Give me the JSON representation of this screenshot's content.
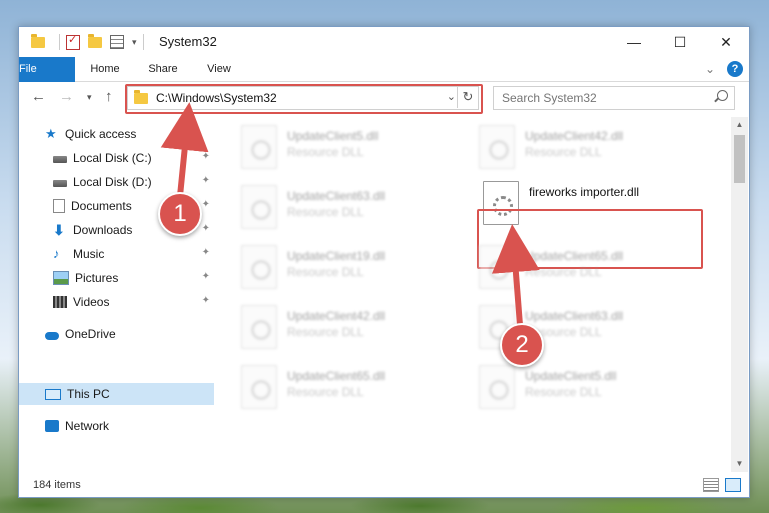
{
  "window": {
    "title": "System32",
    "minimize_label": "—",
    "maximize_label": "☐",
    "close_label": "✕"
  },
  "ribbon": {
    "tabs": [
      {
        "label": "File"
      },
      {
        "label": "Home"
      },
      {
        "label": "Share"
      },
      {
        "label": "View"
      }
    ],
    "expand_label": "⌄",
    "help_label": "?"
  },
  "address_bar": {
    "path": "C:\\Windows\\System32",
    "dropdown": "⌄",
    "refresh": "↻"
  },
  "search": {
    "placeholder": "Search System32"
  },
  "nav_pane": {
    "items": [
      {
        "label": "Quick access"
      },
      {
        "label": "Local Disk (C:)"
      },
      {
        "label": "Local Disk (D:)"
      },
      {
        "label": "Documents"
      },
      {
        "label": "Downloads"
      },
      {
        "label": "Music"
      },
      {
        "label": "Pictures"
      },
      {
        "label": "Videos"
      },
      {
        "label": "OneDrive"
      },
      {
        "label": "This PC"
      },
      {
        "label": "Network"
      }
    ],
    "pin": "📌"
  },
  "files": [
    {
      "name": "UpdateClient5.dll",
      "type": "Resource DLL"
    },
    {
      "name": "UpdateClient42.dll",
      "type": "Resource DLL"
    },
    {
      "name": "UpdateClient63.dll",
      "type": "Resource DLL"
    },
    {
      "name": "fireworks importer.dll",
      "type": ""
    },
    {
      "name": "UpdateClient19.dll",
      "type": "Resource DLL"
    },
    {
      "name": "UpdateClient65.dll",
      "type": "Resource DLL"
    },
    {
      "name": "UpdateClient42.dll",
      "type": "Resource DLL"
    },
    {
      "name": "UpdateClient63.dll",
      "type": "Resource DLL"
    },
    {
      "name": "UpdateClient65.dll",
      "type": "Resource DLL"
    },
    {
      "name": "UpdateClient5.dll",
      "type": "Resource DLL"
    }
  ],
  "status": {
    "item_count": "184 items"
  },
  "annotations": {
    "step1": "1",
    "step2": "2"
  },
  "colors": {
    "accent": "#1979ca",
    "highlight": "#d9534f",
    "selected": "#cce4f7"
  }
}
